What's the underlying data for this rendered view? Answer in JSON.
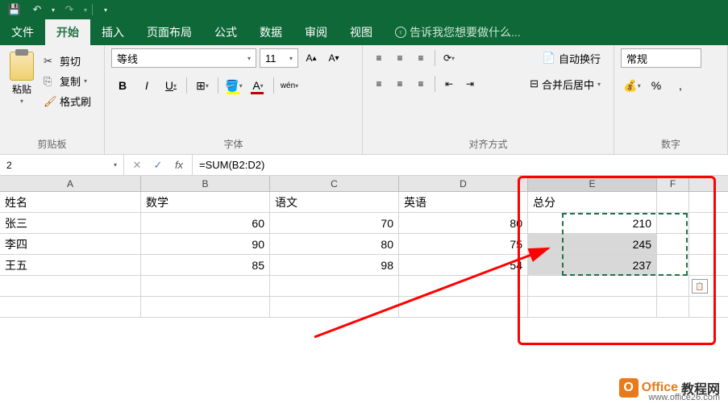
{
  "tabs": {
    "file": "文件",
    "home": "开始",
    "insert": "插入",
    "pagelayout": "页面布局",
    "formulas": "公式",
    "data": "数据",
    "review": "审阅",
    "view": "视图",
    "help": "告诉我您想要做什么..."
  },
  "clipboard": {
    "paste": "粘贴",
    "cut": "剪切",
    "copy": "复制",
    "format_painter": "格式刷",
    "group": "剪贴板"
  },
  "font": {
    "name": "等线",
    "size": "11",
    "group": "字体",
    "wen": "wén"
  },
  "align": {
    "wrap": "自动换行",
    "merge": "合并后居中",
    "group": "对齐方式"
  },
  "number": {
    "format": "常规",
    "group": "数字"
  },
  "formula_bar": {
    "cell": "2",
    "formula": "=SUM(B2:D2)"
  },
  "columns": [
    "A",
    "B",
    "C",
    "D",
    "E",
    "F"
  ],
  "headers": {
    "name": "姓名",
    "math": "数学",
    "chinese": "语文",
    "english": "英语",
    "total": "总分"
  },
  "rows": [
    {
      "name": "张三",
      "math": 60,
      "chinese": 70,
      "english": 80,
      "total": 210
    },
    {
      "name": "李四",
      "math": 90,
      "chinese": 80,
      "english": 75,
      "total": 245
    },
    {
      "name": "王五",
      "math": 85,
      "chinese": 98,
      "english": 54,
      "total": 237
    }
  ],
  "watermark": {
    "text1": "Office",
    "text2": "教程网",
    "url": "www.office26.com"
  },
  "chart_data": {
    "type": "table",
    "title": "",
    "columns": [
      "姓名",
      "数学",
      "语文",
      "英语",
      "总分"
    ],
    "rows": [
      [
        "张三",
        60,
        70,
        80,
        210
      ],
      [
        "李四",
        90,
        80,
        75,
        245
      ],
      [
        "王五",
        85,
        98,
        54,
        237
      ]
    ]
  }
}
